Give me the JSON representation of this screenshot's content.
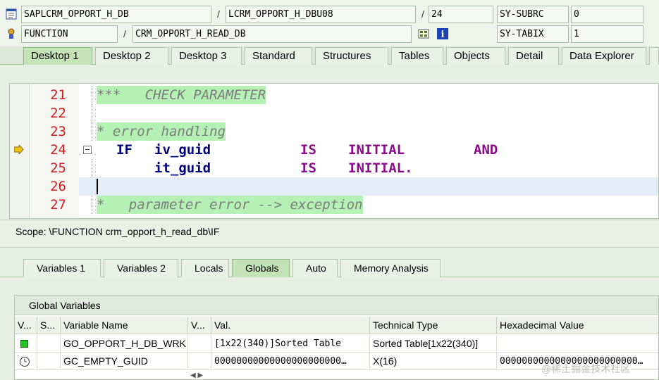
{
  "header": {
    "program": "SAPLCRM_OPPORT_H_DB",
    "include": "LCRM_OPPORT_H_DBU08",
    "line": "24",
    "subrc_label": "SY-SUBRC",
    "subrc_value": "0",
    "event_type": "FUNCTION",
    "event_name": "CRM_OPPORT_H_READ_DB",
    "tabix_label": "SY-TABIX",
    "tabix_value": "1"
  },
  "desktop_tabs": [
    "Desktop 1",
    "Desktop 2",
    "Desktop 3",
    "Standard",
    "Structures",
    "Tables",
    "Objects",
    "Detail",
    "Data Explorer"
  ],
  "editor": {
    "lines": [
      {
        "no": "21",
        "t1": "***   CHECK PARAMETER"
      },
      {
        "no": "22"
      },
      {
        "no": "23",
        "t1": "* error handling"
      },
      {
        "no": "24",
        "kw1": "IF",
        "id": "iv_guid",
        "kw2a": "IS",
        "kw2b": "INITIAL",
        "kw2c": "AND"
      },
      {
        "no": "25",
        "id": "it_guid",
        "kw2a": "IS",
        "kw2b": "INITIAL."
      },
      {
        "no": "26"
      },
      {
        "no": "27",
        "t1": "*   parameter error --> exception"
      }
    ]
  },
  "scope": "Scope: \\FUNCTION crm_opport_h_read_db\\IF",
  "bottom_tabs": [
    "Variables 1",
    "Variables 2",
    "Locals",
    "Globals",
    "Auto",
    "Memory Analysis"
  ],
  "globals": {
    "title": "Global Variables",
    "columns": [
      "V...",
      "S...",
      "Variable Name",
      "V...",
      "Val.",
      "Technical Type",
      "Hexadecimal Value"
    ],
    "rows": [
      {
        "name": "GO_OPPORT_H_DB_WRK",
        "val": "[1x22(340)]Sorted Table",
        "type": "Sorted Table[1x22(340)]",
        "hex": ""
      },
      {
        "name": "GC_EMPTY_GUID",
        "val": "00000000000000000000000…",
        "type": "X(16)",
        "hex": "0000000000000000000000000…"
      }
    ]
  },
  "watermark": "@稀土掘金技术社区"
}
